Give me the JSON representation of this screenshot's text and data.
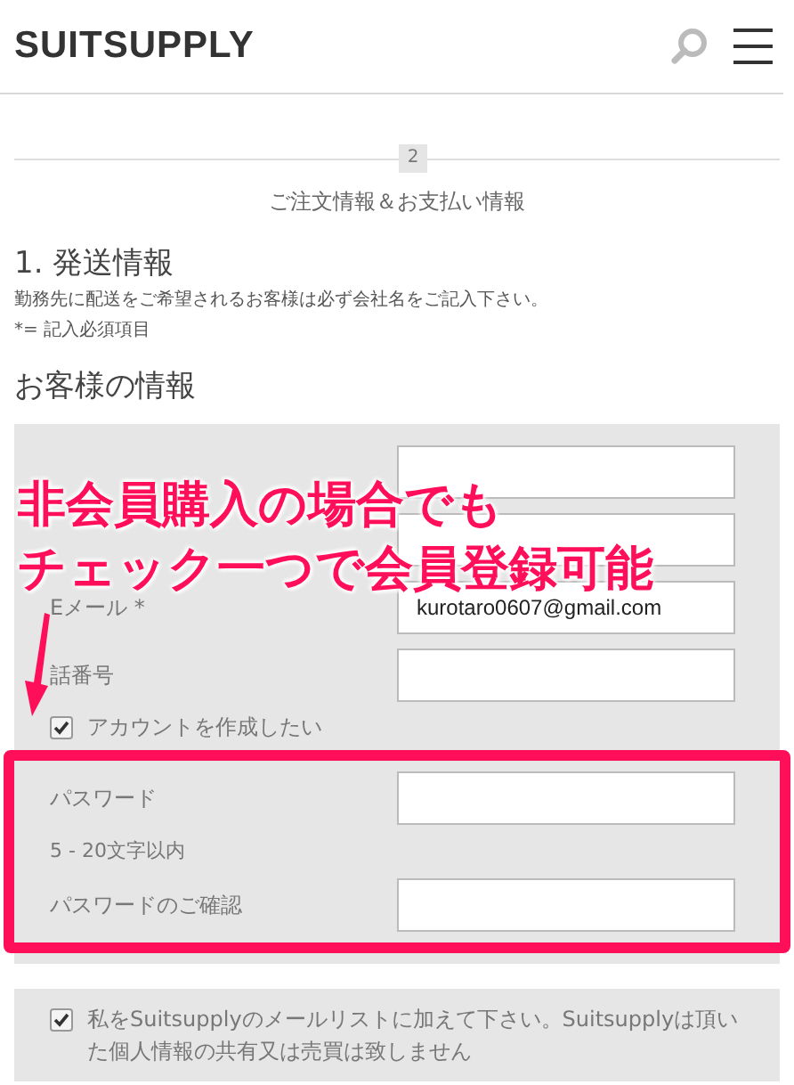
{
  "header": {
    "logo": "SUITSUPPLY"
  },
  "step": {
    "number": "2",
    "title": "ご注文情報＆お支払い情報"
  },
  "shipping": {
    "heading": "1. 発送情報",
    "notes": [
      "勤務先に配送をご希望されるお客様は必ず会社名をご記入下さい。",
      "*= 記入必須項目"
    ]
  },
  "customer": {
    "heading": "お客様の情報",
    "fields": [
      {
        "kind": "input"
      },
      {
        "kind": "input"
      },
      {
        "kind": "input",
        "label": "Eメール *",
        "value": "kurotaro0607@gmail.com"
      },
      {
        "kind": "input",
        "label": "話番号"
      }
    ],
    "account": {
      "label": "アカウントを作成したい",
      "checked": true
    }
  },
  "password": {
    "items": [
      {
        "kind": "field",
        "label": "パスワード"
      },
      {
        "kind": "hint",
        "label": "5 - 20文字以内"
      },
      {
        "kind": "field",
        "label": "パスワードのご確認"
      }
    ]
  },
  "newsletter": {
    "label": "私をSuitsupplyのメールリストに加えて下さい。Suitsupplyは頂いた個人情報の共有又は売買は致しません",
    "checked": true
  },
  "annotation": {
    "lines": [
      "非会員購入の場合でも",
      "チェック一つで会員登録可能"
    ]
  }
}
